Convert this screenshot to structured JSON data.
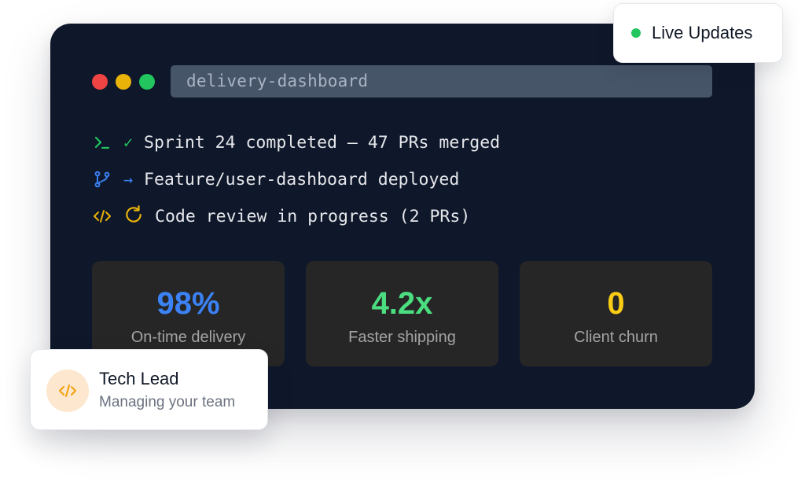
{
  "window": {
    "title": "delivery-dashboard",
    "traffic_lights": [
      "#ef4444",
      "#eab308",
      "#22c55e"
    ]
  },
  "log": [
    {
      "icon": "terminal-prompt-icon",
      "glyph": "✓",
      "text": "Sprint 24 completed – 47 PRs merged",
      "color": "#22c55e"
    },
    {
      "icon": "git-branch-icon",
      "glyph": "→",
      "text": "Feature/user-dashboard deployed",
      "color": "#3b82f6"
    },
    {
      "icon": "code-icon",
      "glyph": "refresh-icon",
      "text": "Code review in progress (2 PRs)",
      "color": "#eab308"
    }
  ],
  "stats": [
    {
      "value": "98%",
      "label": "On-time delivery",
      "color": "#3b82f6"
    },
    {
      "value": "4.2x",
      "label": "Faster shipping",
      "color": "#4ade80"
    },
    {
      "value": "0",
      "label": "Client churn",
      "color": "#facc15"
    }
  ],
  "live": {
    "label": "Live Updates",
    "color": "#22c55e"
  },
  "lead": {
    "icon": "code-icon",
    "title": "Tech Lead",
    "subtitle": "Managing your team",
    "accent": "#f59e0b"
  }
}
